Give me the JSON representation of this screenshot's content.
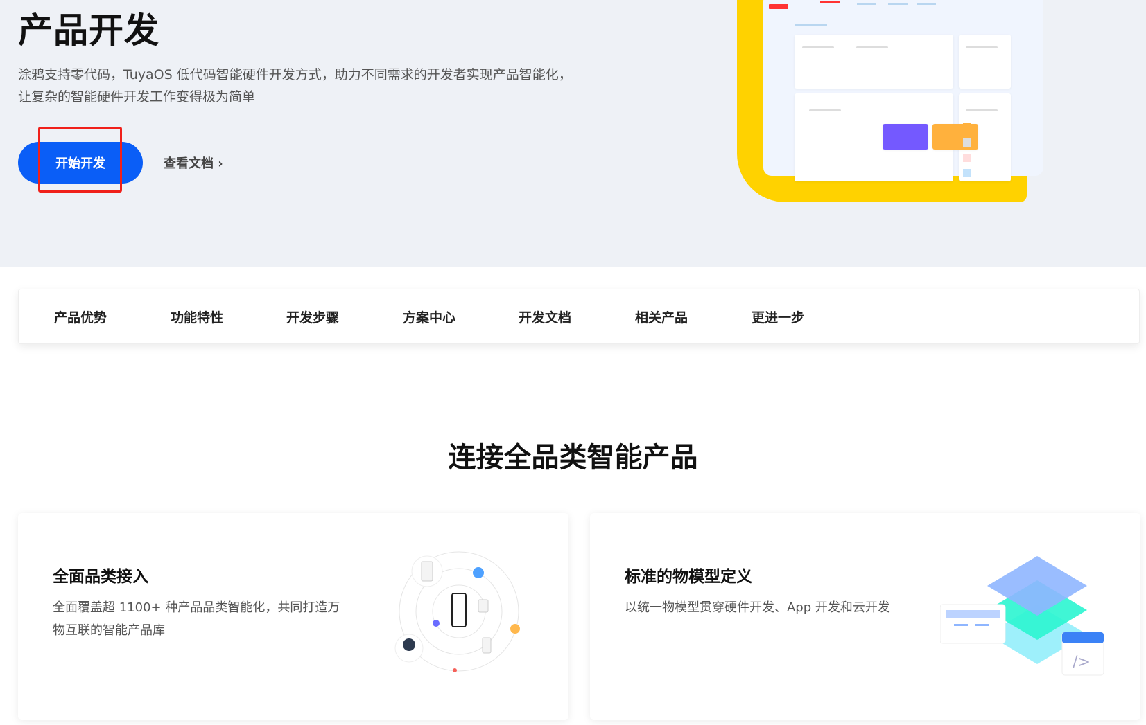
{
  "hero": {
    "title": "产品开发",
    "subtitle": "涂鸦支持零代码，TuyaOS 低代码智能硬件开发方式，助力不同需求的开发者实现产品智能化，让复杂的智能硬件开发工作变得极为简单",
    "start_button": "开始开发",
    "docs_link": "查看文档",
    "docs_chevron": "›",
    "accent": "#0a5ef7"
  },
  "nav": {
    "items": [
      "产品优势",
      "功能特性",
      "开发步骤",
      "方案中心",
      "开发文档",
      "相关产品",
      "更进一步"
    ]
  },
  "section": {
    "title": "连接全品类智能产品"
  },
  "cards": [
    {
      "title": "全面品类接入",
      "desc": "全面覆盖超 1100+ 种产品品类智能化，共同打造万物互联的智能产品库"
    },
    {
      "title": "标准的物模型定义",
      "desc": "以统一物模型贯穿硬件开发、App 开发和云开发"
    }
  ]
}
